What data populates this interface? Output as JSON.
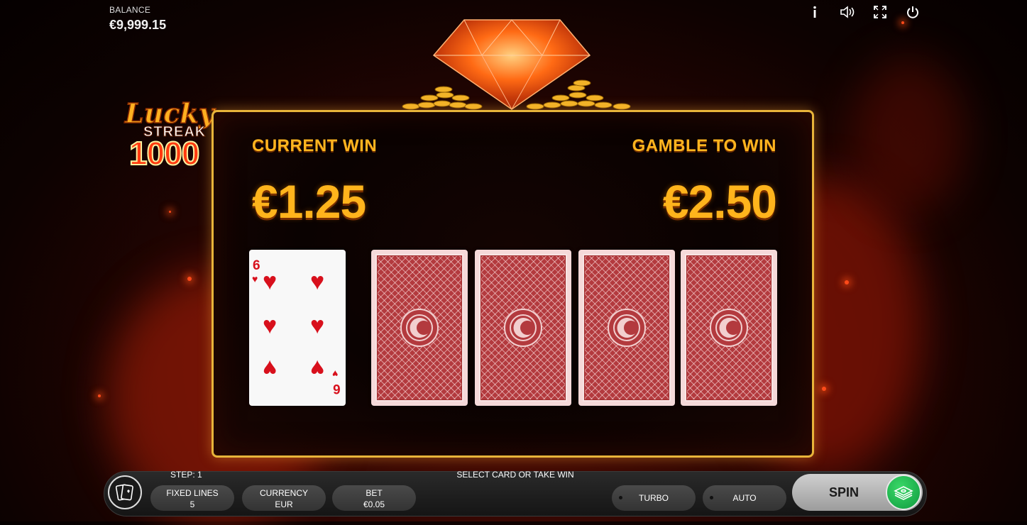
{
  "header": {
    "balance_label": "BALANCE",
    "balance_value": "€9,999.15",
    "icons": [
      "info-icon",
      "sound-icon",
      "fullscreen-icon",
      "power-icon"
    ]
  },
  "logo": {
    "line1": "Lucky",
    "line2": "STREAK",
    "line3": "1000"
  },
  "gamble": {
    "current_win_label": "CURRENT WIN",
    "current_win_value": "€1.25",
    "gamble_to_win_label": "GAMBLE TO WIN",
    "gamble_to_win_value": "€2.50",
    "revealed_card": {
      "rank": "6",
      "suit": "hearts"
    },
    "hidden_cards": 4
  },
  "bottom": {
    "step_label": "STEP: 1",
    "message": "SELECT CARD OR TAKE WIN",
    "fixed_lines": {
      "label": "FIXED LINES",
      "value": "5"
    },
    "currency": {
      "label": "CURRENCY",
      "value": "EUR"
    },
    "bet": {
      "label": "BET",
      "value": "€0.05"
    },
    "turbo_label": "TURBO",
    "auto_label": "AUTO",
    "spin_label": "SPIN"
  },
  "colors": {
    "gold": "#ffb41c",
    "panel_border": "#e8b43a",
    "card_back": "#b33a3e",
    "heart": "#d8101c",
    "spin_go": "#1fb24e"
  }
}
